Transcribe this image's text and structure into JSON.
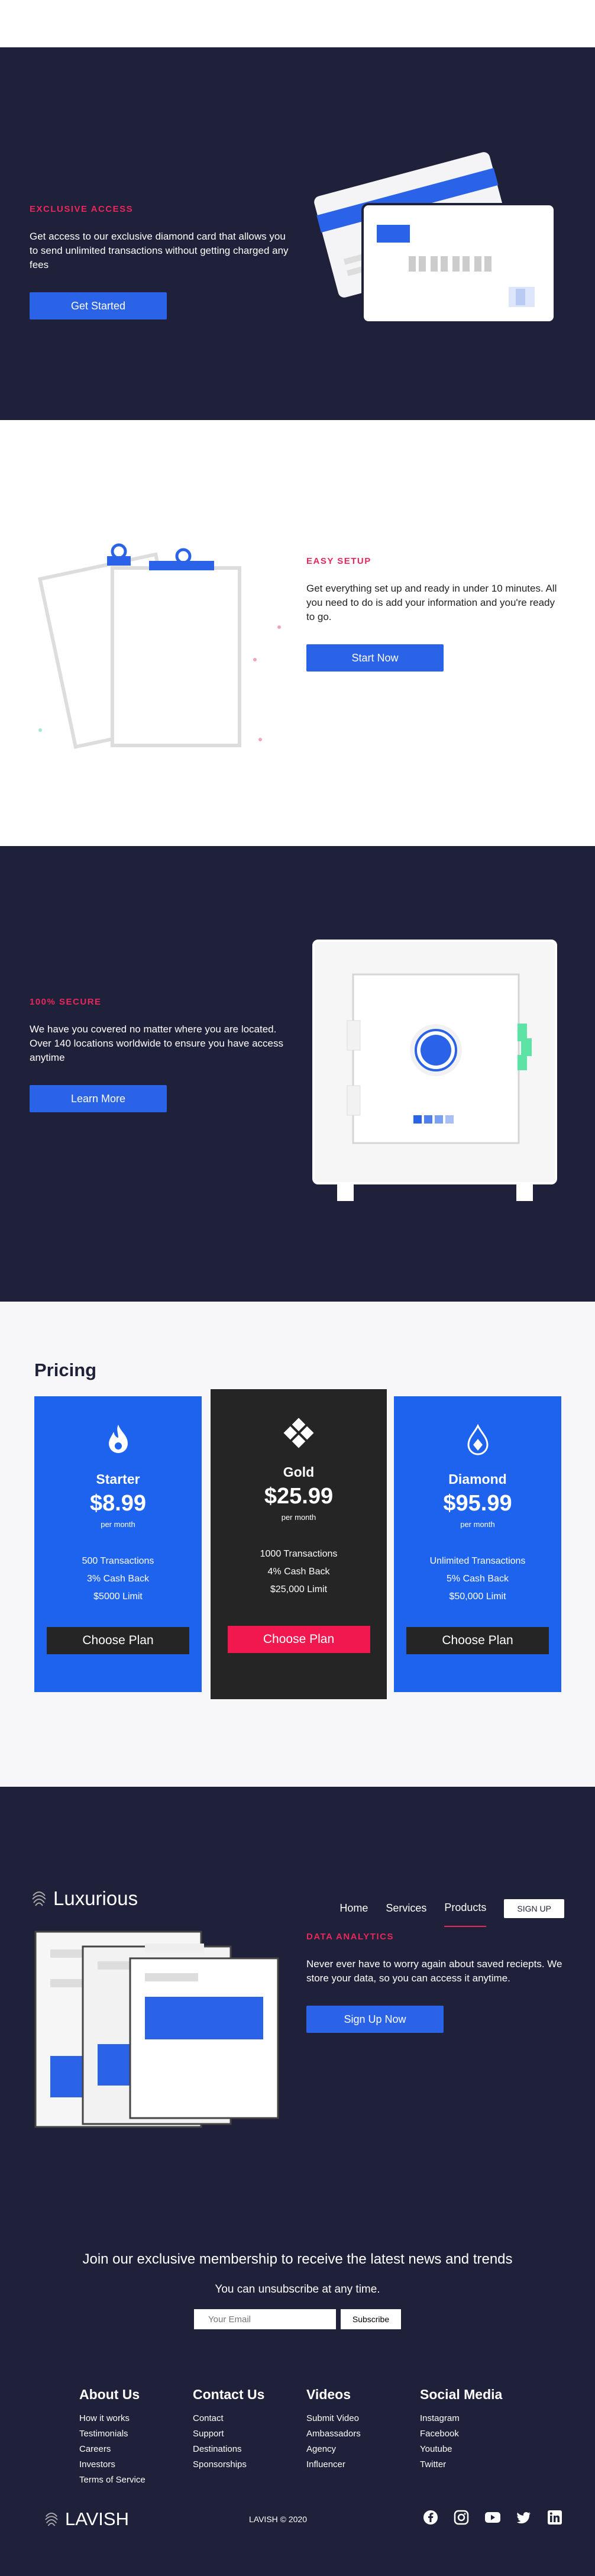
{
  "hero": {
    "eyebrow": "EXCLUSIVE ACCESS",
    "description": "Get access to our exclusive diamond card that allows you to send unlimited transactions without getting charged any fees",
    "button": "Get Started"
  },
  "setup": {
    "eyebrow": "EASY SETUP",
    "description": "Get everything set up and ready in under 10 minutes. All you need to do is add your information and you're ready to go.",
    "button": "Start Now"
  },
  "secure": {
    "eyebrow": "100% SECURE",
    "description": "We have you covered no matter where you are located. Over 140 locations worldwide to ensure you have access anytime",
    "button": "Learn More"
  },
  "pricing": {
    "title": "Pricing",
    "plans": [
      {
        "name": "Starter",
        "price": "$8.99",
        "per": "per month",
        "features": [
          "500 Transactions",
          "3% Cash Back",
          "$5000 Limit"
        ],
        "button": "Choose Plan",
        "icon": "flame-icon"
      },
      {
        "name": "Gold",
        "price": "$25.99",
        "per": "per month",
        "features": [
          "1000 Transactions",
          "4% Cash Back",
          "$25,000 Limit"
        ],
        "button": "Choose Plan",
        "icon": "diamond-tiles-icon"
      },
      {
        "name": "Diamond",
        "price": "$95.99",
        "per": "per month",
        "features": [
          "Unlimited Transactions",
          "5% Cash Back",
          "$50,000 Limit"
        ],
        "button": "Choose Plan",
        "icon": "gem-drop-icon"
      }
    ]
  },
  "nav": {
    "logo": "Luxurious",
    "links": [
      "Home",
      "Services",
      "Products"
    ],
    "signup": "SIGN UP"
  },
  "analytics": {
    "eyebrow": "DATA ANALYTICS",
    "description": "Never ever have to worry again about saved reciepts. We store your data, so you can access it anytime.",
    "button": "Sign Up Now"
  },
  "newsletter": {
    "heading": "Join our exclusive membership to receive the latest news and trends",
    "sub": "You can unsubscribe at any time.",
    "placeholder": "Your Email",
    "button": "Subscribe"
  },
  "footer": {
    "columns": [
      {
        "title": "About Us",
        "links": [
          "How it works",
          "Testimonials",
          "Careers",
          "Investors",
          "Terms of Service"
        ]
      },
      {
        "title": "Contact Us",
        "links": [
          "Contact",
          "Support",
          "Destinations",
          "Sponsorships"
        ]
      },
      {
        "title": "Videos",
        "links": [
          "Submit Video",
          "Ambassadors",
          "Agency",
          "Influencer"
        ]
      },
      {
        "title": "Social Media",
        "links": [
          "Instagram",
          "Facebook",
          "Youtube",
          "Twitter"
        ]
      }
    ],
    "logo": "LAVISH",
    "copyright": "LAVISH © 2020",
    "social_icons": [
      "facebook-icon",
      "instagram-icon",
      "youtube-icon",
      "twitter-icon",
      "linkedin-icon"
    ]
  },
  "colors": {
    "accent": "#2b63e8",
    "pink": "#e8275b",
    "navy": "#1e2139"
  }
}
